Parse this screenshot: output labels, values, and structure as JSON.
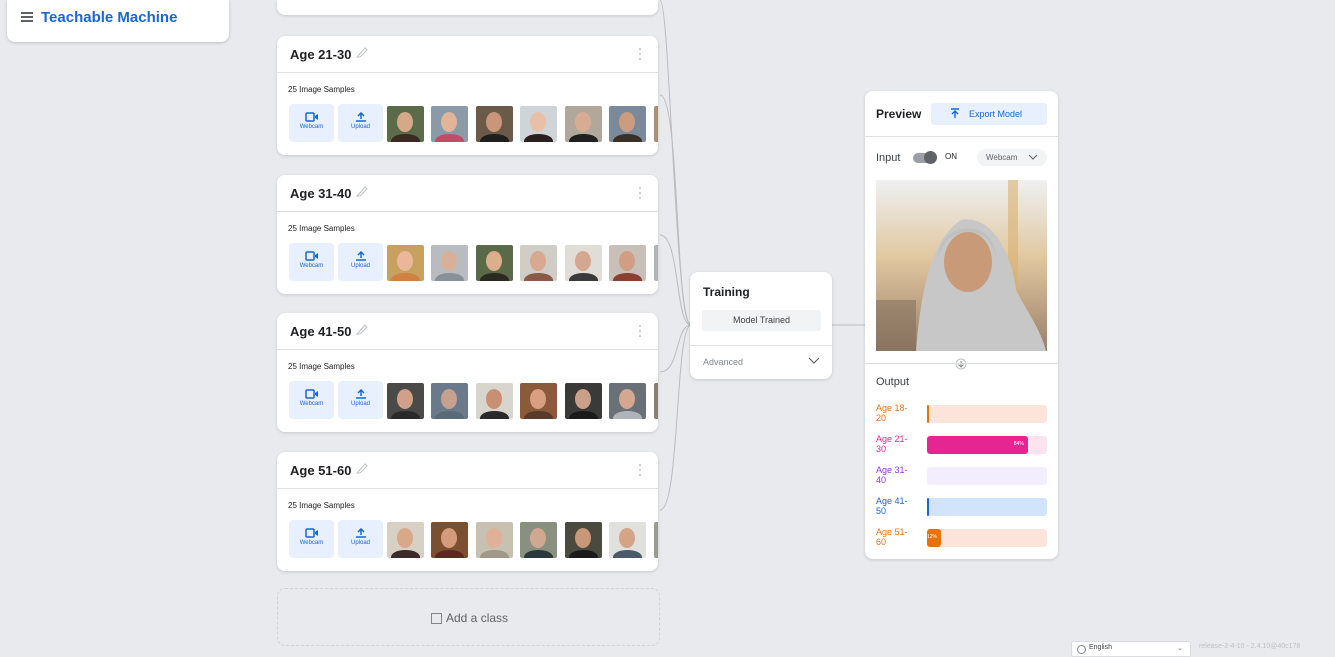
{
  "header": {
    "app_title": "Teachable Machine",
    "menu_icon": "hamburger-menu-icon"
  },
  "classes": [
    {
      "name": "Age 21-30",
      "samples": "25 Image Samples",
      "webcam_label": "Webcam",
      "upload_label": "Upload"
    },
    {
      "name": "Age 31-40",
      "samples": "25 Image Samples",
      "webcam_label": "Webcam",
      "upload_label": "Upload"
    },
    {
      "name": "Age 41-50",
      "samples": "25 Image Samples",
      "webcam_label": "Webcam",
      "upload_label": "Upload"
    },
    {
      "name": "Age 51-60",
      "samples": "25 Image Samples",
      "webcam_label": "Webcam",
      "upload_label": "Upload"
    }
  ],
  "add_class": {
    "label": "Add a class"
  },
  "training": {
    "title": "Training",
    "status_button": "Model Trained",
    "advanced_label": "Advanced"
  },
  "preview": {
    "title": "Preview",
    "export_label": "Export Model",
    "input_label": "Input",
    "toggle_state": "ON",
    "input_source": "Webcam",
    "output_label": "Output",
    "outputs": [
      {
        "label": "Age 18-\n20",
        "value": 0.01,
        "pct_text": "",
        "color": "#e8710a",
        "track": "#fde4da"
      },
      {
        "label": "Age 21-\n30",
        "value": 0.84,
        "pct_text": "84%",
        "color": "#e52592",
        "track": "#fde3ed"
      },
      {
        "label": "Age 31-\n40",
        "value": 0.0,
        "pct_text": "",
        "color": "#9334e6",
        "track": "#f3eefd"
      },
      {
        "label": "Age 41-\n50",
        "value": 0.01,
        "pct_text": "",
        "color": "#1967d2",
        "track": "#d2e3fc"
      },
      {
        "label": "Age 51-\n60",
        "value": 0.12,
        "pct_text": "12%",
        "color": "#e8710a",
        "track": "#fde4da"
      }
    ]
  },
  "footer": {
    "language": "English",
    "release": "release-2-4-10 - 2.4.10@40c178"
  }
}
